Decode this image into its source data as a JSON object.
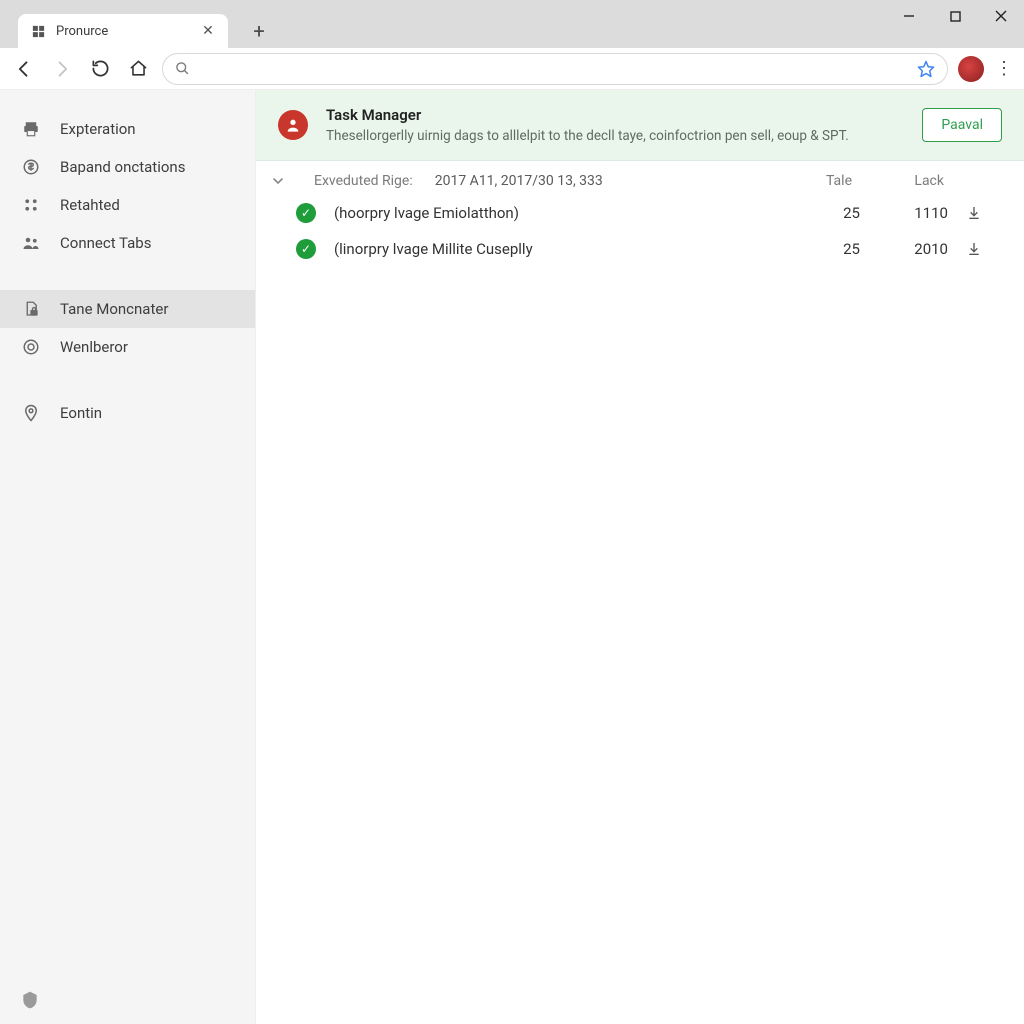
{
  "window": {
    "tab_title": "Pronurce"
  },
  "omnibox": {
    "value": ""
  },
  "sidebar": {
    "group1": [
      {
        "icon": "printer-icon",
        "label": "Expteration"
      },
      {
        "icon": "dollar-icon",
        "label": "Bapand onctations"
      },
      {
        "icon": "grid-icon",
        "label": "Retahted"
      },
      {
        "icon": "people-icon",
        "label": "Connect Tabs"
      }
    ],
    "group2": [
      {
        "icon": "doc-lock-icon",
        "label": "Tane Moncnater",
        "active": true
      },
      {
        "icon": "target-icon",
        "label": "Wenlberor"
      }
    ],
    "group3": [
      {
        "icon": "pin-icon",
        "label": "Eontin"
      }
    ]
  },
  "banner": {
    "title": "Task Manager",
    "description": "Thesellorgerlly uirnig dags to alllelpit to the decll taye, coinfoctrion pen sell, eoup & SPT.",
    "action_label": "Paaval"
  },
  "section": {
    "range_label": "Exveduted Rige:",
    "range_value": "2017 A11, 2017/30 13, 333",
    "col_tale": "Tale",
    "col_lack": "Lack"
  },
  "rows": [
    {
      "status": "ok",
      "name": "(hoorpry lvage Emiolatthon)",
      "tale": "25",
      "lack": "1110"
    },
    {
      "status": "ok",
      "name": "(linorpry lvage Millite Cuseplly",
      "tale": "25",
      "lack": "2010"
    }
  ]
}
